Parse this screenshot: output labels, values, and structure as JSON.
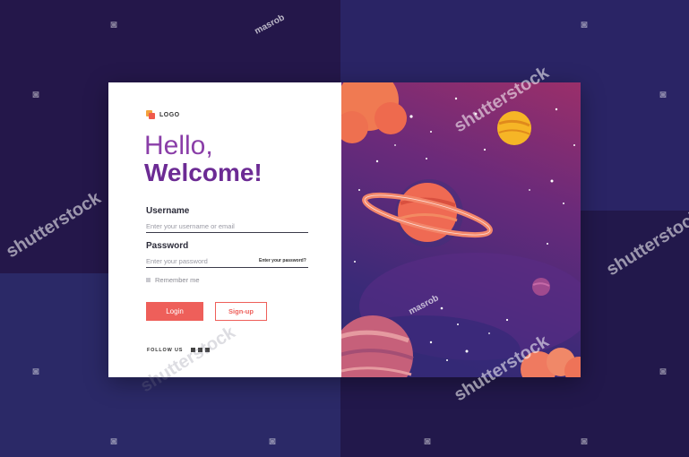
{
  "logo": {
    "text": "LOGO"
  },
  "greeting": {
    "line1": "Hello,",
    "line2": "Welcome!"
  },
  "form": {
    "username_label": "Username",
    "username_placeholder": "Enter your username or email",
    "password_label": "Password",
    "password_placeholder": "Enter your password",
    "forgot_label": "Enter your password?",
    "remember_label": "Remember me",
    "login_label": "Login",
    "signup_label": "Sign-up"
  },
  "footer": {
    "follow_label": "FOLLOW US",
    "social_icons": [
      "facebook-icon",
      "twitter-icon",
      "instagram-icon"
    ]
  },
  "watermarks": {
    "brand": "shutterstock",
    "author": "masrob"
  },
  "colors": {
    "primary": "#ee5f5a",
    "heading": "#6c2b94",
    "card": "#ffffff"
  }
}
